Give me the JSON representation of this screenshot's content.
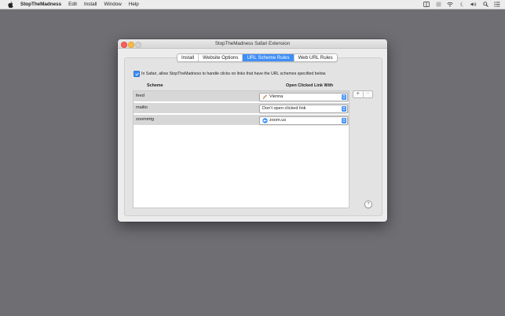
{
  "menubar": {
    "app_name": "StopTheMadness",
    "menus": [
      "Edit",
      "Install",
      "Window",
      "Help"
    ],
    "status_icons": [
      "sidebar-icon",
      "blank-icon",
      "wifi-icon",
      "moon-icon",
      "volume-icon",
      "search-icon",
      "list-icon"
    ]
  },
  "window": {
    "title": "StopTheMadness Safari Extension",
    "tabs": [
      {
        "label": "Install",
        "active": false
      },
      {
        "label": "Website Options",
        "active": false
      },
      {
        "label": "URL Scheme Rules",
        "active": true
      },
      {
        "label": "Web URL Rules",
        "active": false
      }
    ],
    "checkbox": {
      "checked": true,
      "label": "In Safari, allow StopTheMadness to handle clicks on links that have the URL schemes specified below."
    },
    "table": {
      "headers": {
        "scheme": "Scheme",
        "open_with": "Open Clicked Link With"
      },
      "rows": [
        {
          "scheme": "feed",
          "open_with": "Vienna",
          "icon": "vienna-app-icon"
        },
        {
          "scheme": "mailto",
          "open_with": "Don't open clicked link",
          "icon": ""
        },
        {
          "scheme": "zoommtg",
          "open_with": "zoom.us",
          "icon": "zoom-app-icon"
        }
      ]
    },
    "add_label": "+",
    "remove_label": "−",
    "help_label": "?"
  },
  "colors": {
    "accent": "#3e8ef7",
    "desktop": "#6e6e73",
    "row": "#d7d7d7"
  }
}
